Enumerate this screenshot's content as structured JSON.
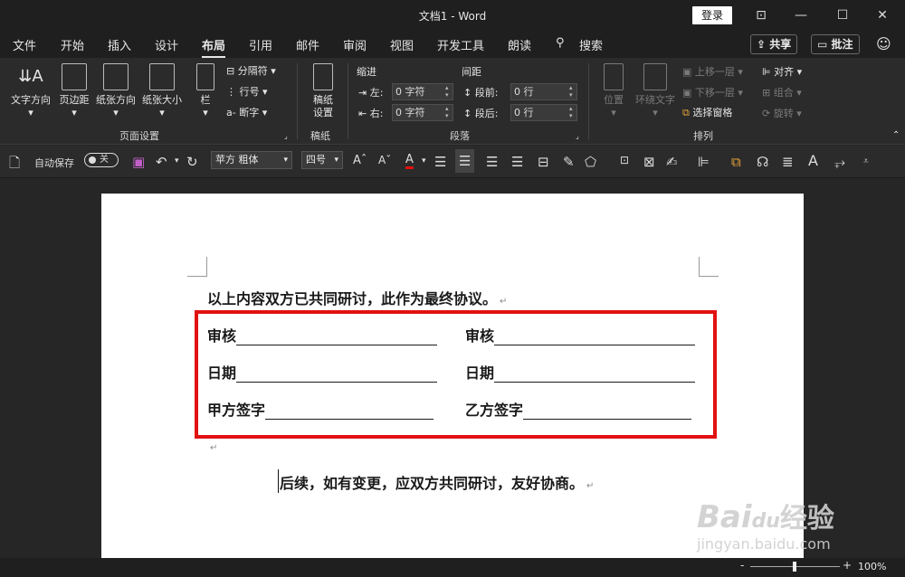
{
  "window": {
    "title": "文档1 - Word",
    "login": "登录",
    "minimize": "—",
    "restore": "☐",
    "close": "✕",
    "ribbon_display": "⊡"
  },
  "menu": {
    "tabs": [
      "文件",
      "开始",
      "插入",
      "设计",
      "布局",
      "引用",
      "邮件",
      "审阅",
      "视图",
      "开发工具",
      "朗读"
    ],
    "active": "布局",
    "search": "搜索",
    "share": "共享",
    "comment": "批注",
    "emoji": "☺"
  },
  "ribbon": {
    "page_setup": {
      "text_direction": "文字方向",
      "margins": "页边距",
      "orientation": "纸张方向",
      "size": "纸张大小",
      "columns": "栏",
      "breaks": "分隔符",
      "line_numbers": "行号",
      "hyphenation": "断字",
      "label": "页面设置"
    },
    "manuscript": {
      "paper": "稿纸\n设置",
      "label": "稿纸"
    },
    "paragraph": {
      "indent_title": "缩进",
      "spacing_title": "间距",
      "left": "左:",
      "right": "右:",
      "before": "段前:",
      "after": "段后:",
      "left_val": "0 字符",
      "right_val": "0 字符",
      "before_val": "0 行",
      "after_val": "0 行",
      "label": "段落"
    },
    "arrange": {
      "position": "位置",
      "wrap": "环绕文字",
      "forward": "上移一层",
      "backward": "下移一层",
      "selection_pane": "选择窗格",
      "align": "对齐",
      "group": "组合",
      "rotate": "旋转",
      "label": "排列"
    }
  },
  "qat": {
    "autosave": "自动保存",
    "toggle": "关",
    "font": "苹方 粗体",
    "size": "四号",
    "font_color": "#e21111"
  },
  "document": {
    "line1": "以上内容双方已共同研讨，此作为最终协议。",
    "rows": [
      {
        "left": "审核",
        "right": "审核"
      },
      {
        "left": "日期",
        "right": "日期"
      },
      {
        "left": "甲方签字",
        "right": "乙方签字"
      }
    ],
    "line2": "后续，如有变更，应双方共同研讨，友好协商。",
    "mark": "↵"
  },
  "status": {
    "zoom": "100%",
    "minus": "-",
    "plus": "+"
  },
  "watermark": {
    "brand": "Bai",
    "paw": "du",
    "product": "经验",
    "url": "jingyan.baidu.com"
  },
  "colors": {
    "highlight_box": "#e21111"
  }
}
